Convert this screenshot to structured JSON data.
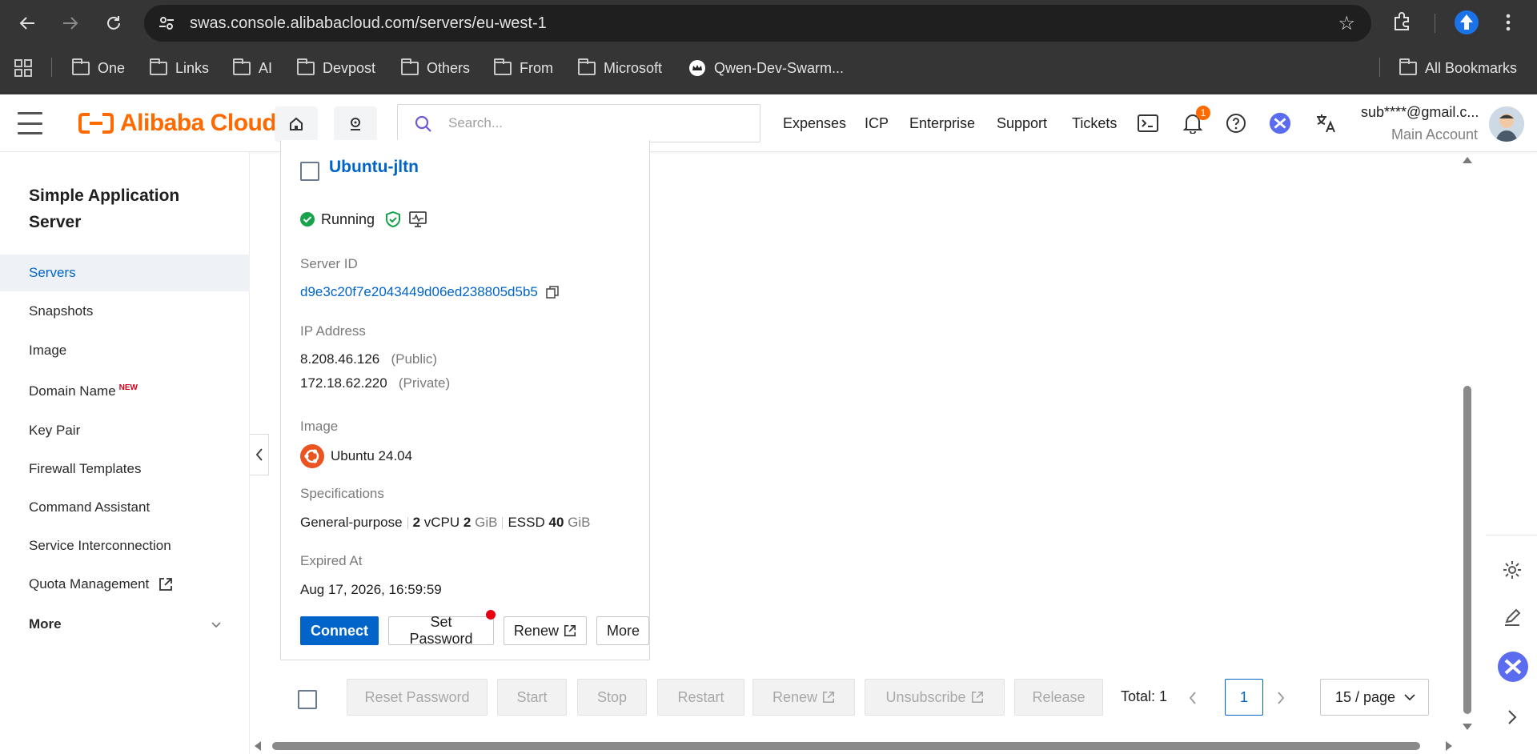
{
  "browser": {
    "url": "swas.console.alibabacloud.com/servers/eu-west-1",
    "bookmarks": [
      "One",
      "Links",
      "AI",
      "Devpost",
      "Others",
      "From",
      "Microsoft",
      "Qwen-Dev-Swarm..."
    ],
    "all_bookmarks": "All Bookmarks"
  },
  "header": {
    "logo": "Alibaba Cloud",
    "search_placeholder": "Search...",
    "links": [
      "Expenses",
      "ICP",
      "Enterprise",
      "Support",
      "Tickets"
    ],
    "notification_count": "1",
    "account_name": "sub****@gmail.c...",
    "account_type": "Main Account"
  },
  "sidebar": {
    "title": "Simple Application Server",
    "items": [
      {
        "label": "Servers",
        "active": true
      },
      {
        "label": "Snapshots"
      },
      {
        "label": "Image"
      },
      {
        "label": "Domain Name",
        "tag": "NEW"
      },
      {
        "label": "Key Pair"
      },
      {
        "label": "Firewall Templates"
      },
      {
        "label": "Command Assistant"
      },
      {
        "label": "Service Interconnection"
      },
      {
        "label": "Quota Management"
      }
    ],
    "more": "More"
  },
  "server": {
    "name": "Ubuntu-jltn",
    "status": "Running",
    "server_id_label": "Server ID",
    "server_id": "d9e3c20f7e2043449d06ed238805d5b5",
    "ip_label": "IP Address",
    "public_ip": "8.208.46.126",
    "public_tag": "(Public)",
    "private_ip": "172.18.62.220",
    "private_tag": "(Private)",
    "image_label": "Image",
    "image": "Ubuntu 24.04",
    "spec_label": "Specifications",
    "spec_type": "General-purpose",
    "vcpu_num": "2",
    "vcpu_unit": "vCPU",
    "mem_num": "2",
    "mem_unit": "GiB",
    "disk_type": "ESSD",
    "disk_num": "40",
    "disk_unit": "GiB",
    "expired_label": "Expired At",
    "expired": "Aug 17, 2026, 16:59:59",
    "actions": {
      "connect": "Connect",
      "set_password": "Set Password",
      "renew": "Renew",
      "more": "More"
    }
  },
  "bulk": {
    "reset_password": "Reset Password",
    "start": "Start",
    "stop": "Stop",
    "restart": "Restart",
    "renew": "Renew",
    "unsubscribe": "Unsubscribe",
    "release": "Release",
    "total": "Total: 1",
    "page": "1",
    "per_page": "15 / page"
  },
  "colors": {
    "brand": "#ff6a00",
    "link": "#0064c8",
    "running": "#16a34a"
  }
}
